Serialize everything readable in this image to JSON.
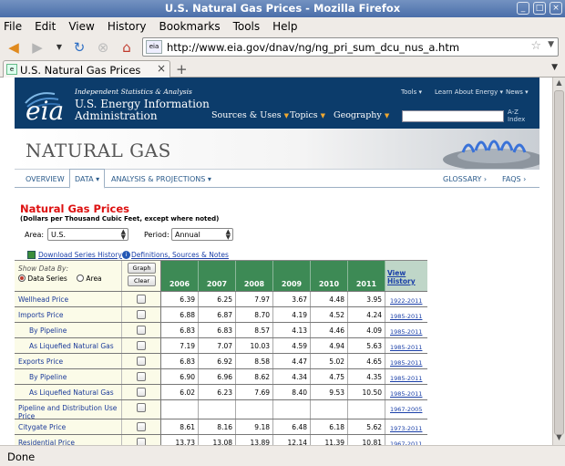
{
  "window": {
    "title": "U.S. Natural Gas Prices - Mozilla Firefox"
  },
  "menu": [
    "File",
    "Edit",
    "View",
    "History",
    "Bookmarks",
    "Tools",
    "Help"
  ],
  "nav": {
    "url": "http://www.eia.gov/dnav/ng/ng_pri_sum_dcu_nus_a.htm",
    "site_badge": "eia"
  },
  "tab": {
    "label": "U.S. Natural Gas Prices"
  },
  "status": "Done",
  "eia": {
    "tagline": "Independent Statistics & Analysis",
    "logo_text": "eia",
    "agency_line1": "U.S. Energy Information",
    "agency_line2": "Administration",
    "top_links": [
      "Tools ▾",
      "Learn About Energy ▾",
      "News ▾"
    ],
    "main_nav": [
      "Sources & Uses",
      "Topics",
      "Geography"
    ],
    "az_index": [
      "A-Z",
      "Index"
    ]
  },
  "banner": {
    "title": "NATURAL GAS"
  },
  "subnav": {
    "left": [
      "OVERVIEW",
      "DATA ▾",
      "ANALYSIS & PROJECTIONS ▾"
    ],
    "right": [
      "GLOSSARY ›",
      "FAQS ›"
    ]
  },
  "page": {
    "title": "Natural Gas Prices",
    "subtitle": "(Dollars per Thousand Cubic Feet, except where noted)",
    "area_label": "Area:",
    "area_value": "U.S.",
    "period_label": "Period:",
    "period_value": "Annual"
  },
  "table": {
    "download_link": "Download Series History",
    "defs_link": "Definitions, Sources & Notes",
    "show_by": "Show Data By:",
    "radio_series": "Data Series",
    "radio_area": "Area",
    "graph_btn": "Graph",
    "clear_btn": "Clear",
    "years": [
      "2006",
      "2007",
      "2008",
      "2009",
      "2010",
      "2011"
    ],
    "view_history": "View History",
    "rows": [
      {
        "label": "Wellhead Price",
        "indent": false,
        "values": [
          "6.39",
          "6.25",
          "7.97",
          "3.67",
          "4.48",
          "3.95"
        ],
        "history": "1922-2011"
      },
      {
        "label": "Imports Price",
        "indent": false,
        "values": [
          "6.88",
          "6.87",
          "8.70",
          "4.19",
          "4.52",
          "4.24"
        ],
        "history": "1985-2011"
      },
      {
        "label": "By Pipeline",
        "indent": true,
        "values": [
          "6.83",
          "6.83",
          "8.57",
          "4.13",
          "4.46",
          "4.09"
        ],
        "history": "1985-2011"
      },
      {
        "label": "As Liquefied Natural Gas",
        "indent": true,
        "values": [
          "7.19",
          "7.07",
          "10.03",
          "4.59",
          "4.94",
          "5.63"
        ],
        "history": "1985-2011"
      },
      {
        "label": "Exports Price",
        "indent": false,
        "values": [
          "6.83",
          "6.92",
          "8.58",
          "4.47",
          "5.02",
          "4.65"
        ],
        "history": "1985-2011"
      },
      {
        "label": "By Pipeline",
        "indent": true,
        "values": [
          "6.90",
          "6.96",
          "8.62",
          "4.34",
          "4.75",
          "4.35"
        ],
        "history": "1985-2011"
      },
      {
        "label": "As Liquefied Natural Gas",
        "indent": true,
        "values": [
          "6.02",
          "6.23",
          "7.69",
          "8.40",
          "9.53",
          "10.50"
        ],
        "history": "1985-2011"
      },
      {
        "label": "Pipeline and Distribution Use Price",
        "indent": false,
        "values": [
          "",
          "",
          "",
          "",
          "",
          ""
        ],
        "history": "1967-2005"
      },
      {
        "label": "Citygate Price",
        "indent": false,
        "values": [
          "8.61",
          "8.16",
          "9.18",
          "6.48",
          "6.18",
          "5.62"
        ],
        "history": "1973-2011"
      },
      {
        "label": "Residential Price",
        "indent": false,
        "values": [
          "13.73",
          "13.08",
          "13.89",
          "12.14",
          "11.39",
          "10.81"
        ],
        "history": "1967-2011"
      }
    ]
  }
}
